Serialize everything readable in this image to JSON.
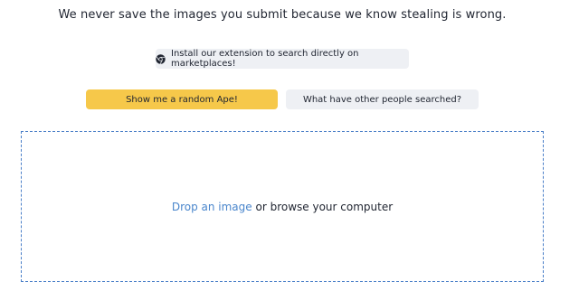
{
  "headline": "We never save the images you submit because we know stealing is wrong.",
  "extension_button": {
    "label": "Install our extension to search directly on marketplaces!",
    "icon": "chrome-icon"
  },
  "random_button": {
    "label": "Show me a random Ape!",
    "color": "#f6c84a"
  },
  "searched_button": {
    "label": "What have other people searched?"
  },
  "dropzone": {
    "link_text": "Drop an image",
    "rest_text": "or browse your computer",
    "border_color": "#4a7fc8",
    "link_color": "#4a86cc"
  }
}
